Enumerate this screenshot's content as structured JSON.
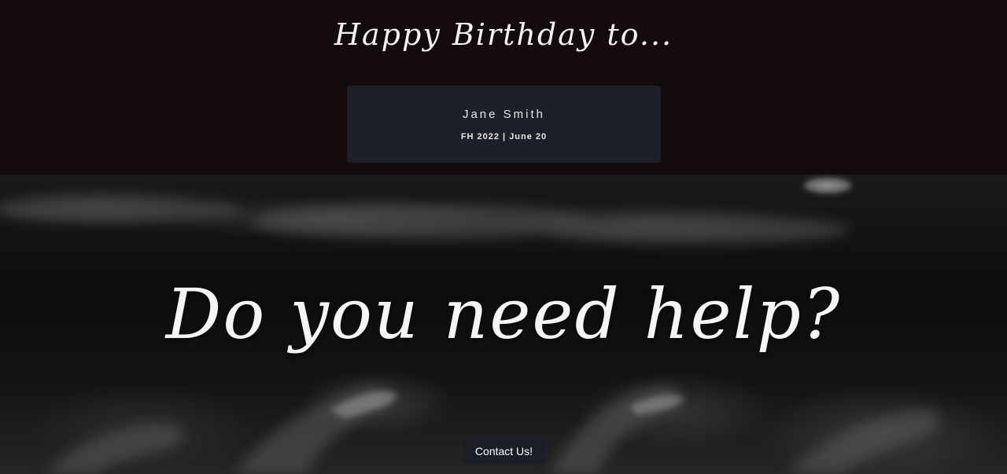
{
  "header": {
    "heading": "Happy Birthday to..."
  },
  "person_card": {
    "name": "Jane Smith",
    "meta": "FH 2022 | June 20"
  },
  "hero": {
    "heading": "Do you need help?",
    "background_image": "hands-reaching-icon",
    "contact_button_label": "Contact Us!"
  },
  "colors": {
    "top_band": "#140c0c",
    "card": "#1e2028",
    "button": "#1c1e27",
    "text": "#f3f1f1"
  }
}
